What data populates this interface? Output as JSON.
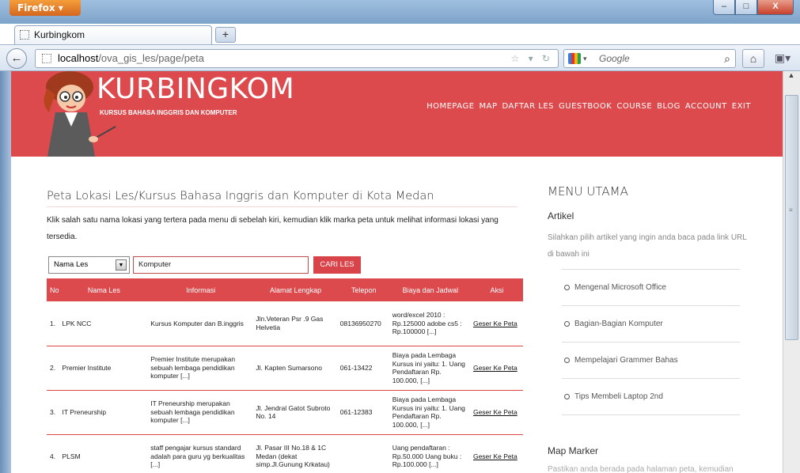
{
  "browser": {
    "menu_button": "Firefox ▾",
    "tab_title": "Kurbingkom",
    "new_tab": "+",
    "url_host": "localhost",
    "url_path": "/ova_gis_les/page/peta",
    "search_placeholder": "Google",
    "window_min": "–",
    "window_max": "□",
    "window_close": "X"
  },
  "site": {
    "title": "KURBINGKOM",
    "subtitle": "KURSUS BAHASA INGGRIS DAN KOMPUTER",
    "nav": [
      "HOMEPAGE",
      "MAP",
      "DAFTAR LES",
      "GUESTBOOK",
      "COURSE",
      "BLOG",
      "ACCOUNT",
      "EXIT"
    ]
  },
  "main": {
    "heading": "Peta Lokasi Les/Kursus Bahasa Inggris dan Komputer di Kota Medan",
    "intro": "Klik salah satu nama lokasi yang tertera pada menu di sebelah kiri, kemudian klik marka peta untuk melihat informasi lokasi yang tersedia.",
    "filter": {
      "select_value": "Nama Les",
      "input_value": "Komputer",
      "button": "CARI LES"
    },
    "table": {
      "headers": [
        "No",
        "Nama Les",
        "Informasi",
        "Alamat Lengkap",
        "Telepon",
        "Biaya dan Jadwal",
        "Aksi"
      ],
      "rows": [
        [
          "1.",
          "LPK NCC",
          "Kursus Komputer dan B.inggris",
          "Jln.Veteran Psr .9 Gas Helvetia",
          "08136950270",
          "word/excel 2010 : Rp.125000 adobe cs5 : Rp.100000 [...]",
          "Geser Ke Peta"
        ],
        [
          "2.",
          "Premier Institute",
          "Premier Institute merupakan sebuah lembaga pendidikan komputer [...]",
          "Jl. Kapten Sumarsono",
          "061-13422",
          "Biaya pada Lembaga Kursus ini yaitu: 1. Uang Pendaftaran Rp. 100.000, [...]",
          "Geser Ke Peta"
        ],
        [
          "3.",
          "IT Preneurship",
          "IT Preneurship merupakan sebuah lembaga pendidikan komputer [...]",
          "Jl. Jendral Gatot Subroto No. 14",
          "061-12383",
          "Biaya pada Lembaga Kursus ini yaitu: 1. Uang Pendaftaran Rp. 100.000, [...]",
          "Geser Ke Peta"
        ],
        [
          "4.",
          "PLSM",
          "staff pengajar kursus standard adalah para guru yg berkualitas [...]",
          "Jl. Pasar III No.18 & 1C Medan (dekat simp.Jl.Gunung Krkatau)",
          "",
          "Uang pendaftaran : Rp.50.000 Uang buku : Rp.100.000 [...]",
          "Geser Ke Peta"
        ]
      ]
    }
  },
  "sidebar": {
    "title": "MENU UTAMA",
    "section": "Artikel",
    "desc": "Silahkan pilih artikel yang ingin anda baca pada link URL di bawah ini",
    "links": [
      "Mengenal Microsoft Office",
      "Bagian-Bagian Komputer",
      "Mempelajari Grammer Bahas",
      "Tips Membeli Laptop 2nd"
    ],
    "map_marker": "Map Marker",
    "map_desc": "Pastikan anda berada pada halaman peta, kemudian"
  }
}
